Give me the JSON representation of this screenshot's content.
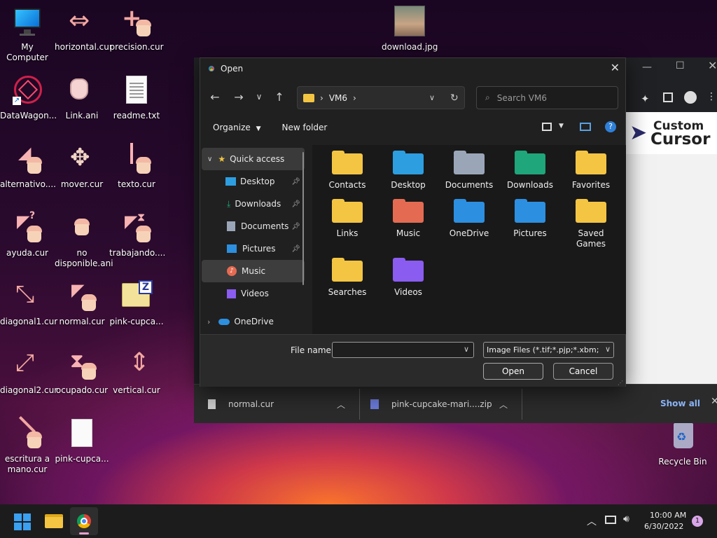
{
  "desktop": {
    "icons": [
      {
        "label": "My Computer"
      },
      {
        "label": "horizontal.cur"
      },
      {
        "label": "precision.cur"
      },
      {
        "label": "download.jpg"
      },
      {
        "label": "DataWagon..."
      },
      {
        "label": "Link.ani"
      },
      {
        "label": "readme.txt"
      },
      {
        "label": "alternativo...."
      },
      {
        "label": "mover.cur"
      },
      {
        "label": "texto.cur"
      },
      {
        "label": "ayuda.cur"
      },
      {
        "label": "no disponible.ani"
      },
      {
        "label": "trabajando...."
      },
      {
        "label": "diagonal1.cur"
      },
      {
        "label": "normal.cur"
      },
      {
        "label": "pink-cupca..."
      },
      {
        "label": "diagonal2.cur"
      },
      {
        "label": "ocupado.cur"
      },
      {
        "label": "vertical.cur"
      },
      {
        "label": "escritura a mano.cur"
      },
      {
        "label": "pink-cupca..."
      },
      {
        "label": "Recycle Bin"
      }
    ]
  },
  "browser": {
    "logo_line1": "Custom",
    "logo_line2": "Cursor",
    "downloads": [
      {
        "name": "normal.cur"
      },
      {
        "name": "pink-cupcake-mari....zip"
      }
    ],
    "show_all": "Show all"
  },
  "dialog": {
    "title": "Open",
    "breadcrumb": "VM6",
    "search_placeholder": "Search VM6",
    "organize": "Organize",
    "new_folder": "New folder",
    "nav_items": [
      {
        "label": "Quick access"
      },
      {
        "label": "Desktop"
      },
      {
        "label": "Downloads"
      },
      {
        "label": "Documents"
      },
      {
        "label": "Pictures"
      },
      {
        "label": "Music"
      },
      {
        "label": "Videos"
      },
      {
        "label": "OneDrive"
      }
    ],
    "files": [
      {
        "label": "Contacts",
        "color": "#f4c542"
      },
      {
        "label": "Desktop",
        "color": "#2d9ee0"
      },
      {
        "label": "Documents",
        "color": "#9aa6b8"
      },
      {
        "label": "Downloads",
        "color": "#1fa67a"
      },
      {
        "label": "Favorites",
        "color": "#f4c542"
      },
      {
        "label": "Links",
        "color": "#f4c542"
      },
      {
        "label": "Music",
        "color": "#e46b52"
      },
      {
        "label": "OneDrive",
        "color": "#2d8fe0"
      },
      {
        "label": "Pictures",
        "color": "#2d8fe0"
      },
      {
        "label": "Saved Games",
        "color": "#f4c542"
      },
      {
        "label": "Searches",
        "color": "#f4c542"
      },
      {
        "label": "Videos",
        "color": "#8a5cf0"
      }
    ],
    "file_name_label": "File name:",
    "file_name_value": "",
    "filter": "Image Files (*.tif;*.pjp;*.xbm;*.jxl",
    "open_button": "Open",
    "cancel_button": "Cancel"
  },
  "taskbar": {
    "time": "10:00 AM",
    "date": "6/30/2022",
    "notification_count": "1"
  }
}
